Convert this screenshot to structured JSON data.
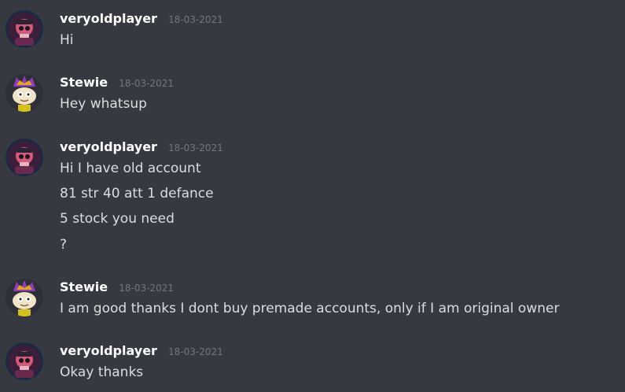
{
  "colors": {
    "background": "#36393f",
    "username": "#ffffff",
    "timestamp": "#72767d",
    "message_text": "#dcddde"
  },
  "messages": [
    {
      "author": "veryoldplayer",
      "avatar_icon": "skull-avatar-icon",
      "timestamp": "18-03-2021",
      "lines": [
        "Hi"
      ]
    },
    {
      "author": "Stewie",
      "avatar_icon": "stewie-avatar-icon",
      "timestamp": "18-03-2021",
      "lines": [
        "Hey whatsup"
      ]
    },
    {
      "author": "veryoldplayer",
      "avatar_icon": "skull-avatar-icon",
      "timestamp": "18-03-2021",
      "lines": [
        "Hi I have old account",
        "81 str 40 att 1 defance",
        "5 stock you need",
        "?"
      ]
    },
    {
      "author": "Stewie",
      "avatar_icon": "stewie-avatar-icon",
      "timestamp": "18-03-2021",
      "lines": [
        "I am good thanks I dont buy premade accounts, only if I am original owner"
      ]
    },
    {
      "author": "veryoldplayer",
      "avatar_icon": "skull-avatar-icon",
      "timestamp": "18-03-2021",
      "lines": [
        "Okay thanks"
      ]
    }
  ]
}
